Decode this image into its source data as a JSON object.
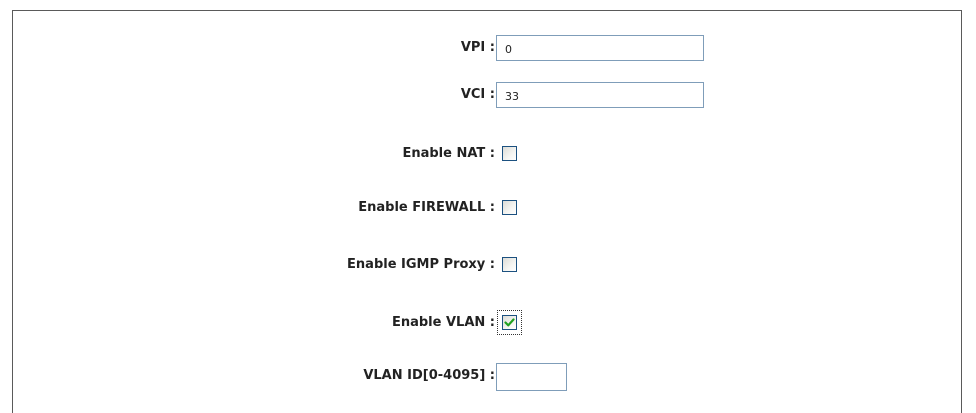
{
  "form": {
    "vpi": {
      "label": "VPI :",
      "value": "0"
    },
    "vci": {
      "label": "VCI :",
      "value": "33"
    },
    "nat": {
      "label": "Enable NAT :",
      "checked": false
    },
    "firewall": {
      "label": "Enable FIREWALL :",
      "checked": false
    },
    "igmp": {
      "label": "Enable IGMP Proxy :",
      "checked": false
    },
    "vlan": {
      "label": "Enable VLAN :",
      "checked": true
    },
    "vlan_id": {
      "label": "VLAN ID[0-4095] :",
      "value": ""
    }
  },
  "colors": {
    "input_border": "#7f9db9",
    "checkbox_border": "#1c5180",
    "check_mark": "#21a121",
    "label_text": "#222222"
  },
  "icons": {
    "check": "check-mark-icon"
  }
}
